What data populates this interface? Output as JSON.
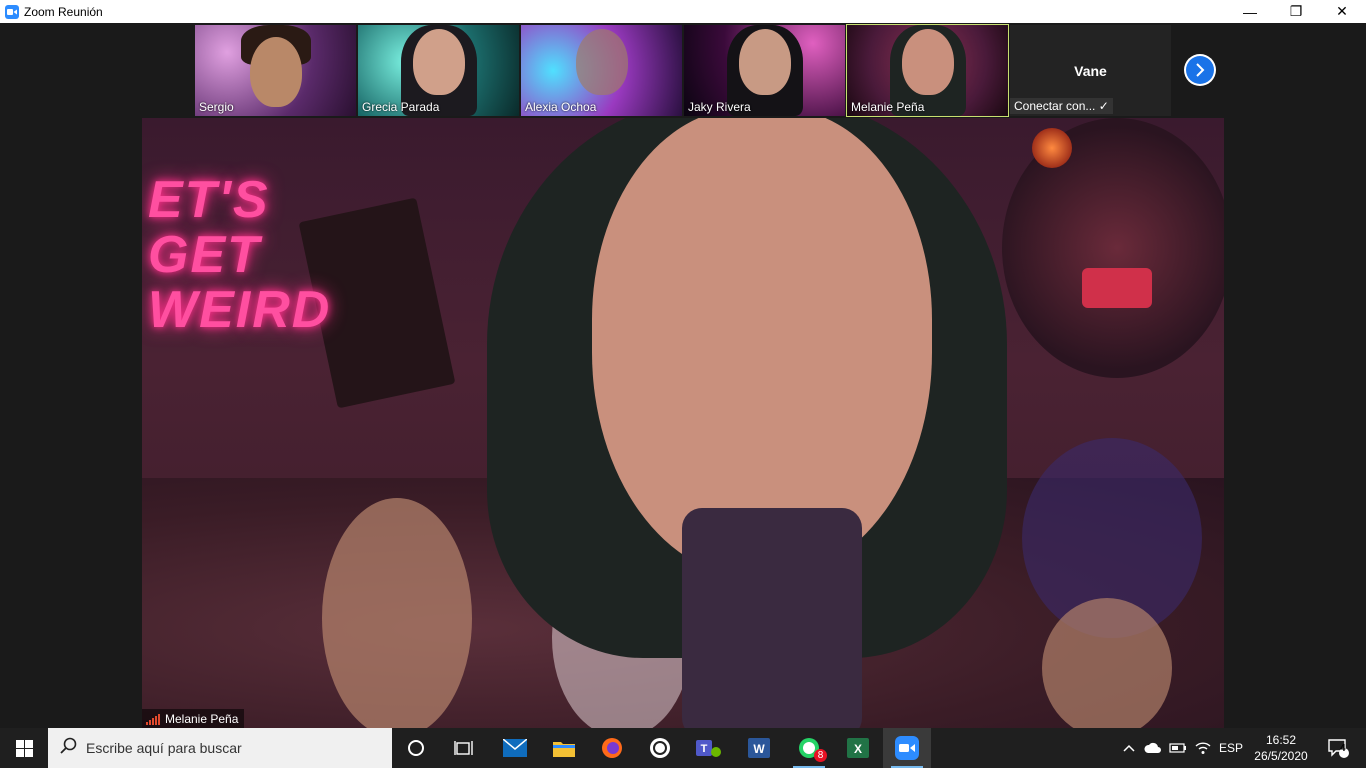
{
  "window": {
    "title": "Zoom Reunión",
    "controls": {
      "minimize": "—",
      "maximize": "❐",
      "close": "✕"
    }
  },
  "participants": [
    {
      "name": "Sergio",
      "colors": [
        "#5a2a6a",
        "#b07ab0"
      ]
    },
    {
      "name": "Grecia Parada",
      "colors": [
        "#1b6b6a",
        "#46d0c0"
      ]
    },
    {
      "name": "Alexia Ochoa",
      "colors": [
        "#3a2a7a",
        "#e070c0"
      ]
    },
    {
      "name": "Jaky Rivera",
      "colors": [
        "#1a0a2a",
        "#c040a0"
      ]
    },
    {
      "name": "Melanie Peña",
      "colors": [
        "#4a1a3a",
        "#d04070"
      ]
    }
  ],
  "camera_off_participant": {
    "name": "Vane",
    "status": "Conectar con... ✓"
  },
  "main_video": {
    "speaker_name": "Melanie Peña",
    "neon_sign": [
      "ET'S",
      "GET",
      "WEIRD"
    ]
  },
  "taskbar": {
    "search_placeholder": "Escribe aquí para buscar",
    "apps": [
      "task-view",
      "mail",
      "file-explorer",
      "firefox",
      "webex",
      "teams",
      "word-app",
      "whatsapp",
      "excel",
      "zoom"
    ],
    "whatsapp_badge": "8",
    "language": "ESP",
    "time": "16:52",
    "date": "26/5/2020",
    "notifications_count": "4"
  },
  "colors": {
    "zoom_blue": "#2d8cff",
    "active_border": "#c8e070",
    "taskbar": "#1f1f1f",
    "neon_pink": "#ff4fa0"
  }
}
